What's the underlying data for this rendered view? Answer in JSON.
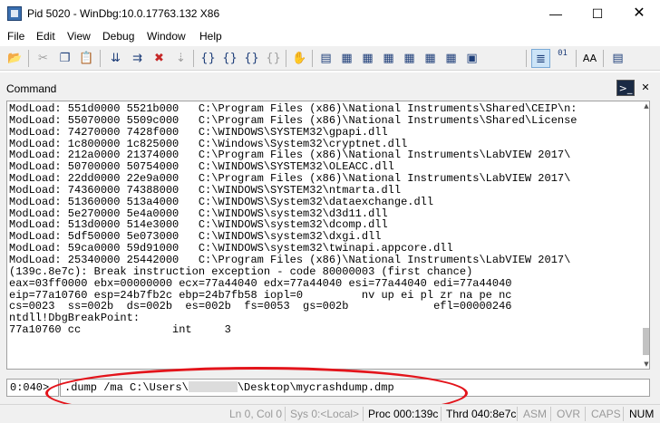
{
  "window": {
    "title": "Pid 5020 - WinDbg:10.0.17763.132 X86",
    "min_glyph": "—",
    "max_glyph": "☐",
    "close_glyph": "✕"
  },
  "menu": [
    "File",
    "Edit",
    "View",
    "Debug",
    "Window",
    "Help"
  ],
  "toolbar": {
    "buttons": [
      {
        "icon": "open-folder-icon",
        "glyph": "📂"
      },
      {
        "icon": "cut-icon",
        "glyph": "✂"
      },
      {
        "icon": "copy-icon",
        "glyph": "❐"
      },
      {
        "icon": "paste-icon",
        "glyph": "📋"
      },
      {
        "icon": "go-icon",
        "glyph": "⇊"
      },
      {
        "icon": "restart-icon",
        "glyph": "⇉"
      },
      {
        "icon": "stop-debugging-icon",
        "glyph": "✖"
      },
      {
        "icon": "break-icon",
        "glyph": "⇣"
      },
      {
        "icon": "step-into-icon",
        "glyph": "{}"
      },
      {
        "icon": "step-over-icon",
        "glyph": "{}"
      },
      {
        "icon": "step-out-icon",
        "glyph": "{}"
      },
      {
        "icon": "run-to-cursor-icon",
        "glyph": "{}"
      },
      {
        "icon": "hand-icon",
        "glyph": "✋"
      },
      {
        "icon": "command-window-icon",
        "glyph": "▤"
      },
      {
        "icon": "watch-window-icon",
        "glyph": "▦"
      },
      {
        "icon": "locals-window-icon",
        "glyph": "▦"
      },
      {
        "icon": "registers-window-icon",
        "glyph": "▦"
      },
      {
        "icon": "memory-window-icon",
        "glyph": "▦"
      },
      {
        "icon": "call-stack-window-icon",
        "glyph": "▦"
      },
      {
        "icon": "disassembly-window-icon",
        "glyph": "▦"
      },
      {
        "icon": "scratch-pad-icon",
        "glyph": "▣"
      },
      {
        "icon": "source-mode-icon",
        "glyph": "≣"
      },
      {
        "icon": "hex-mode-icon",
        "glyph": "01"
      },
      {
        "icon": "font-icon",
        "glyph": "AA"
      },
      {
        "icon": "options-icon",
        "glyph": "▤"
      }
    ]
  },
  "pane": {
    "title": "Command",
    "console_glyph": ">_",
    "close_glyph": "✕"
  },
  "output_lines": [
    "ModLoad: 551d0000 5521b000   C:\\Program Files (x86)\\National Instruments\\Shared\\CEIP\\n:",
    "ModLoad: 55070000 5509c000   C:\\Program Files (x86)\\National Instruments\\Shared\\License",
    "ModLoad: 74270000 7428f000   C:\\WINDOWS\\SYSTEM32\\gpapi.dll",
    "ModLoad: 1c800000 1c825000   C:\\Windows\\System32\\cryptnet.dll",
    "ModLoad: 212a0000 21374000   C:\\Program Files (x86)\\National Instruments\\LabVIEW 2017\\",
    "ModLoad: 50700000 50754000   C:\\WINDOWS\\SYSTEM32\\OLEACC.dll",
    "ModLoad: 22dd0000 22e9a000   C:\\Program Files (x86)\\National Instruments\\LabVIEW 2017\\",
    "ModLoad: 74360000 74388000   C:\\WINDOWS\\SYSTEM32\\ntmarta.dll",
    "ModLoad: 51360000 513a4000   C:\\WINDOWS\\System32\\dataexchange.dll",
    "ModLoad: 5e270000 5e4a0000   C:\\WINDOWS\\system32\\d3d11.dll",
    "ModLoad: 513d0000 514e3000   C:\\WINDOWS\\system32\\dcomp.dll",
    "ModLoad: 5df50000 5e073000   C:\\WINDOWS\\system32\\dxgi.dll",
    "ModLoad: 59ca0000 59d91000   C:\\WINDOWS\\system32\\twinapi.appcore.dll",
    "ModLoad: 25340000 25442000   C:\\Program Files (x86)\\National Instruments\\LabVIEW 2017\\",
    "(139c.8e7c): Break instruction exception - code 80000003 (first chance)",
    "eax=03ff0000 ebx=00000000 ecx=77a44040 edx=77a44040 esi=77a44040 edi=77a44040",
    "eip=77a10760 esp=24b7fb2c ebp=24b7fb58 iopl=0         nv up ei pl zr na pe nc",
    "cs=0023  ss=002b  ds=002b  es=002b  fs=0053  gs=002b             efl=00000246",
    "ntdll!DbgBreakPoint:",
    "77a10760 cc              int     3"
  ],
  "scroll": {
    "up_glyph": "▲",
    "down_glyph": "▼"
  },
  "command": {
    "prompt": "0:040>",
    "input_prefix": ".dump /ma C:\\Users\\",
    "input_suffix": "\\Desktop\\mycrashdump.dmp"
  },
  "annotation_color": "#e3141b",
  "status": {
    "ln_col": "Ln 0, Col 0",
    "sys": "Sys 0:<Local>",
    "proc": "Proc 000:139c",
    "thrd": "Thrd 040:8e7c",
    "asm": "ASM",
    "ovr": "OVR",
    "caps": "CAPS",
    "num": "NUM"
  }
}
